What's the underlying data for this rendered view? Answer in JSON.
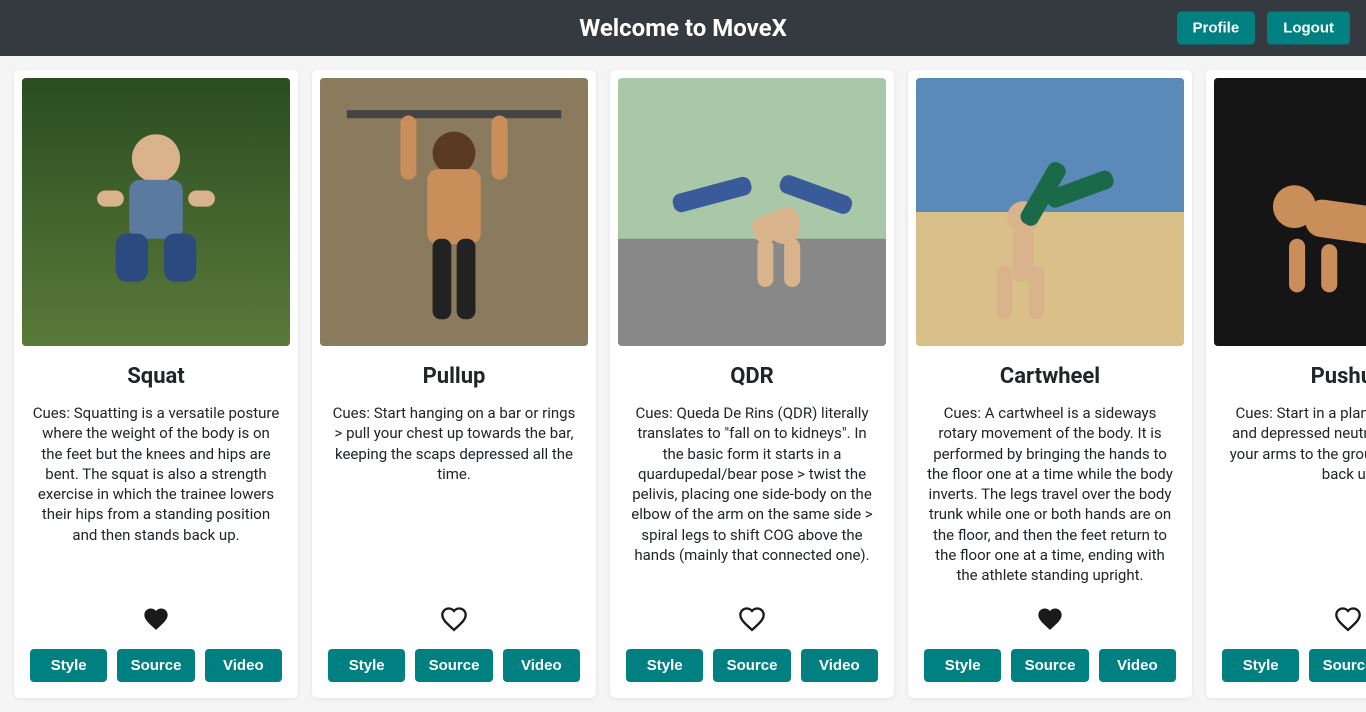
{
  "header": {
    "title": "Welcome to MoveX",
    "profile_label": "Profile",
    "logout_label": "Logout"
  },
  "button_labels": {
    "style": "Style",
    "source": "Source",
    "video": "Video"
  },
  "cards": [
    {
      "title": "Squat",
      "cues": "Cues: Squatting is a versatile posture where the weight of the body is on the feet but the knees and hips are bent. The squat is also a strength exercise in which the trainee lowers their hips from a standing position and then stands back up.",
      "favorited": true,
      "img_class": "img-squat"
    },
    {
      "title": "Pullup",
      "cues": "Cues: Start hanging on a bar or rings > pull your chest up towards the bar, keeping the scaps depressed all the time.",
      "favorited": false,
      "img_class": "img-pullup"
    },
    {
      "title": "QDR",
      "cues": "Cues: Queda De Rins (QDR) literally translates to \"fall on to kidneys\". In the basic form it starts in a quardupedal/bear pose > twist the pelivis, placing one side-body on the elbow of the arm on the same side > spiral legs to shift COG above the hands (mainly that connected one).",
      "favorited": false,
      "img_class": "img-qdr"
    },
    {
      "title": "Cartwheel",
      "cues": "Cues: A cartwheel is a sideways rotary movement of the body. It is performed by bringing the hands to the floor one at a time while the body inverts. The legs travel over the body trunk while one or both hands are on the floor, and then the feet return to the floor one at a time, ending with the athlete standing upright.",
      "favorited": true,
      "img_class": "img-cartwheel"
    },
    {
      "title": "Pushup",
      "cues": "Cues: Start in a plank > protracted and depressed neutral as you bend your arms to the ground and extend back up",
      "favorited": false,
      "img_class": "img-pushup"
    }
  ]
}
